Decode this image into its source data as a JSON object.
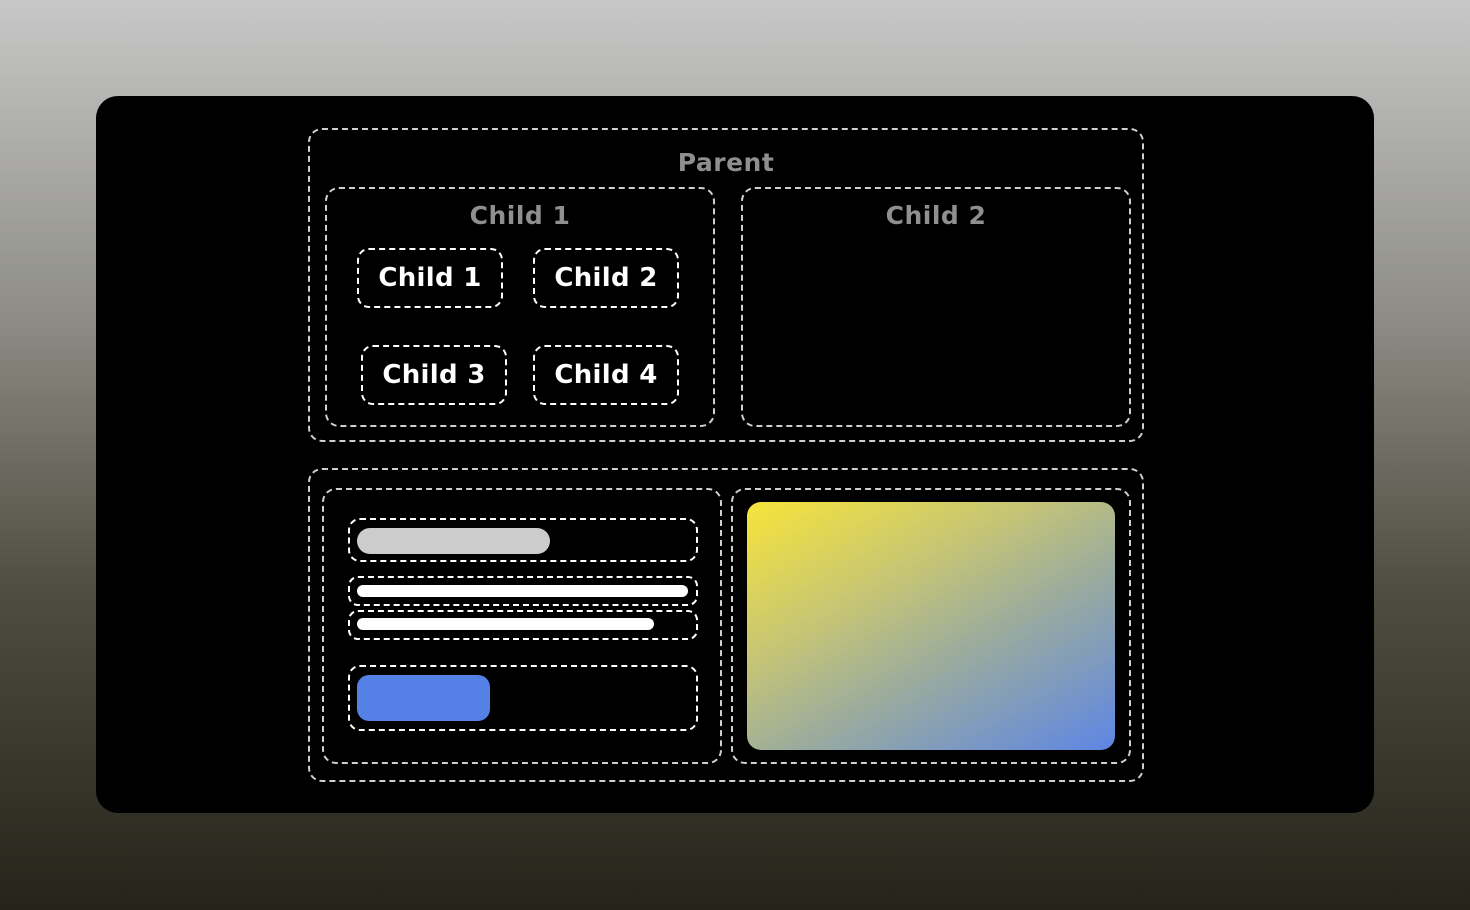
{
  "diagram": {
    "parent_label": "Parent",
    "child1_label": "Child 1",
    "child2_label": "Child 2",
    "grid_children": [
      "Child 1",
      "Child 2",
      "Child 3",
      "Child 4"
    ]
  },
  "colors": {
    "card_background": "#000000",
    "dashed_border": "#cfcfcf",
    "muted_label": "#8f8f8f",
    "placeholder_title": "#cccccc",
    "placeholder_line": "#ffffff",
    "button_accent": "#5580e6",
    "gradient_start": "#f7e43a",
    "gradient_end": "#5d86e5"
  }
}
